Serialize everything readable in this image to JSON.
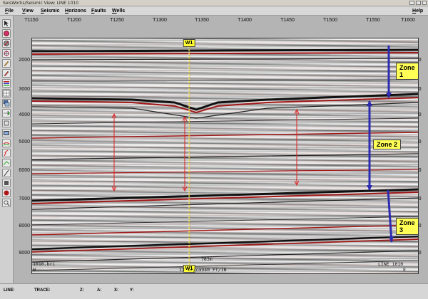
{
  "window": {
    "title": "SeisWorks/Seismic View: LINE 1010"
  },
  "menu": {
    "file": "File",
    "view": "View",
    "seismic": "Seismic",
    "horizons": "Horizons",
    "faults": "Faults",
    "wells": "Wells",
    "help": "Help"
  },
  "toolbar": {
    "tools": [
      "pointer-tool-icon",
      "circle-red-tool-icon",
      "circle-grey-tool-icon",
      "crosshair-tool-icon",
      "pencil-tool-icon",
      "pencil2-tool-icon",
      "bars-tool-icon",
      "grid-tool-icon",
      "stack-tool-icon",
      "arrow-tool-icon",
      "box-tool-icon",
      "film-tool-icon",
      "layers-tool-icon",
      "fault-tool-icon",
      "horizon-tool-icon",
      "slash-tool-icon",
      "stop-tool-icon",
      "record-tool-icon",
      "zoom-tool-icon"
    ]
  },
  "section": {
    "x_ticks": [
      "T1150",
      "T1200",
      "T1250",
      "T1300",
      "T1350",
      "T1400",
      "T1450",
      "T1500",
      "T1550",
      "T1600"
    ],
    "y_ticks": [
      "2000",
      "3000",
      "4000",
      "5000",
      "6000",
      "7000",
      "8000",
      "9000"
    ],
    "well_top": "W1",
    "well_bottom": "W1",
    "zones": [
      "Zone 1",
      "Zone 2",
      "Zone 3"
    ],
    "file_name": "1010.bri",
    "line_name": "LINE 1010",
    "scale_bar": "783m",
    "scale_text": "12 tr/cm940 FT/IN",
    "dir_left": "W",
    "dir_right": "E",
    "colors": {
      "horizon": "#a01818",
      "zone_arrow": "#2c2cb0",
      "thickness_arrow": "#e02020",
      "label_bg": "#ffff55"
    }
  },
  "status": {
    "line": "LINE:",
    "trace": "TRACE:",
    "z": "Z:",
    "a": "A:",
    "x": "X:",
    "y": "Y:"
  }
}
